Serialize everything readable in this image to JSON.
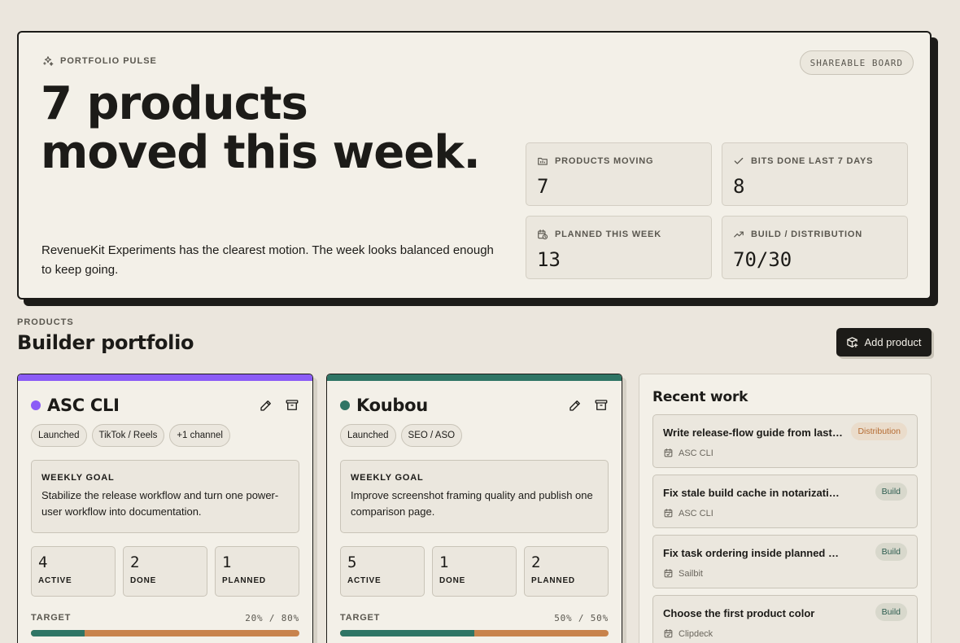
{
  "hero": {
    "eyebrow": "PORTFOLIO PULSE",
    "share_label": "SHAREABLE BOARD",
    "title": "7 products moved this week.",
    "subtitle": "RevenueKit Experiments has the clearest motion. The week looks balanced enough to keep going.",
    "stats": [
      {
        "label": "PRODUCTS MOVING",
        "value": "7",
        "icon": "folder-icon"
      },
      {
        "label": "BITS DONE LAST 7 DAYS",
        "value": "8",
        "icon": "check-icon"
      },
      {
        "label": "PLANNED THIS WEEK",
        "value": "13",
        "icon": "calendar-clock-icon"
      },
      {
        "label": "BUILD / DISTRIBUTION",
        "value": "70/30",
        "icon": "trending-up-icon"
      }
    ]
  },
  "section": {
    "eyebrow": "PRODUCTS",
    "title": "Builder portfolio",
    "add_label": "Add product"
  },
  "products": [
    {
      "name": "ASC CLI",
      "color": "#8b5cf6",
      "tags": [
        "Launched",
        "TikTok / Reels",
        "+1 channel"
      ],
      "goal_label": "WEEKLY GOAL",
      "goal": "Stabilize the release workflow and turn one power-user workflow into documentation.",
      "counts": [
        {
          "value": "4",
          "label": "ACTIVE"
        },
        {
          "value": "2",
          "label": "DONE"
        },
        {
          "value": "1",
          "label": "PLANNED"
        }
      ],
      "target_label": "TARGET",
      "target_value": "20% / 80%",
      "build_fraction": 0.2
    },
    {
      "name": "Koubou",
      "color": "#2f7565",
      "tags": [
        "Launched",
        "SEO / ASO"
      ],
      "goal_label": "WEEKLY GOAL",
      "goal": "Improve screenshot framing quality and publish one comparison page.",
      "counts": [
        {
          "value": "5",
          "label": "ACTIVE"
        },
        {
          "value": "1",
          "label": "DONE"
        },
        {
          "value": "2",
          "label": "PLANNED"
        }
      ],
      "target_label": "TARGET",
      "target_value": "50% / 50%",
      "build_fraction": 0.5
    }
  ],
  "recent": {
    "title": "Recent work",
    "items": [
      {
        "title": "Write release-flow guide from last ...",
        "badge": "Distribution",
        "kind": "dist",
        "product": "ASC CLI"
      },
      {
        "title": "Fix stale build cache in notarization com...",
        "badge": "Build",
        "kind": "build",
        "product": "ASC CLI"
      },
      {
        "title": "Fix task ordering inside planned week la...",
        "badge": "Build",
        "kind": "build",
        "product": "Sailbit"
      },
      {
        "title": "Choose the first product color",
        "badge": "Build",
        "kind": "build",
        "product": "Clipdeck"
      }
    ]
  },
  "colors": {
    "ink": "#1c1b18",
    "paper": "#f3f0e8",
    "distribution": "#c8834c"
  }
}
